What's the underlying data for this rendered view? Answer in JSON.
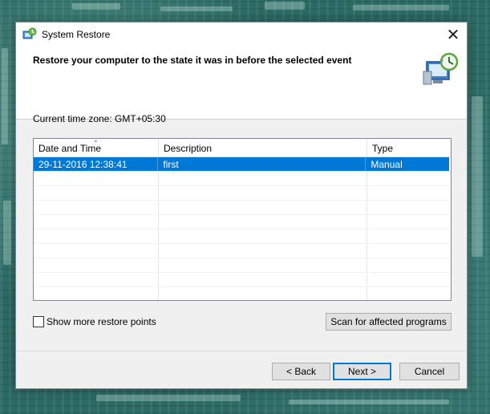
{
  "window": {
    "title": "System Restore",
    "heading": "Restore your computer to the state it was in before the selected event",
    "close_glyph": "✕"
  },
  "timezone_label": "Current time zone: GMT+05:30",
  "table": {
    "columns": [
      "Date and Time",
      "Description",
      "Type"
    ],
    "sort_indicator": "⌄",
    "rows": [
      {
        "date": "29-11-2016 12:38:41",
        "description": "first",
        "type": "Manual",
        "selected": true
      }
    ]
  },
  "checkbox": {
    "label": "Show more restore points",
    "checked": false
  },
  "buttons": {
    "scan": "Scan for affected programs",
    "back": "< Back",
    "next": "Next >",
    "cancel": "Cancel"
  },
  "icons": {
    "title": "system-restore-icon",
    "header": "system-restore-large-icon"
  },
  "colors": {
    "selection": "#0078d7",
    "default_button_border": "#0078d7"
  }
}
